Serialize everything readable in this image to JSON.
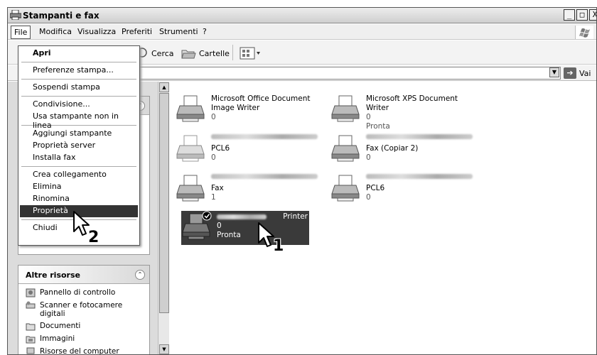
{
  "window": {
    "title": "Stampanti e fax",
    "controls": [
      "_",
      "□",
      "X"
    ]
  },
  "menubar": {
    "items": [
      "File",
      "Modifica",
      "Visualizza",
      "Preferiti",
      "Strumenti",
      "?"
    ]
  },
  "toolbar": {
    "search_label": "Cerca",
    "folders_label": "Cartelle"
  },
  "addressbar": {
    "go_label": "Vai"
  },
  "file_menu": {
    "items": [
      {
        "label": "Apri"
      },
      {
        "label": "Preferenze stampa..."
      },
      {
        "label": "Sospendi stampa"
      },
      {
        "label": "Condivisione..."
      },
      {
        "label": "Usa stampante non in linea"
      },
      {
        "label": "Aggiungi stampante"
      },
      {
        "label": "Proprietà server"
      },
      {
        "label": "Installa fax"
      },
      {
        "label": "Crea collegamento"
      },
      {
        "label": "Elimina"
      },
      {
        "label": "Rinomina"
      },
      {
        "label": "Proprietà"
      },
      {
        "label": "Chiudi"
      }
    ]
  },
  "left_panel": {
    "other_places_title": "Altre risorse",
    "links": [
      {
        "label": "Pannello di controllo",
        "icon": "control-panel-icon"
      },
      {
        "label": "Scanner e fotocamere digitali",
        "icon": "scanner-icon"
      },
      {
        "label": "Documenti",
        "icon": "documents-folder-icon"
      },
      {
        "label": "Immagini",
        "icon": "pictures-folder-icon"
      },
      {
        "label": "Risorse del computer",
        "icon": "my-computer-icon"
      }
    ]
  },
  "printers": [
    {
      "name_line1": "Microsoft Office Document",
      "name_line2": "Image Writer",
      "docs": "0",
      "status": ""
    },
    {
      "name_line1": "Microsoft XPS Document Writer",
      "name_line2": "",
      "docs": "0",
      "status": "Pronta"
    },
    {
      "name_line1": "",
      "name_line2": "PCL6",
      "docs": "0",
      "status": ""
    },
    {
      "name_line1": "",
      "name_line2": "Fax (Copiar 2)",
      "docs": "0",
      "status": ""
    },
    {
      "name_line1": "",
      "name_line2": "Fax",
      "docs": "1",
      "status": ""
    },
    {
      "name_line1": "",
      "name_line2": "PCL6",
      "docs": "0",
      "status": ""
    },
    {
      "name_line1": "Printer",
      "name_line2": "",
      "docs": "0",
      "status": "Pronta"
    }
  ],
  "annotations": {
    "cursor_1": "1",
    "cursor_2": "2"
  }
}
